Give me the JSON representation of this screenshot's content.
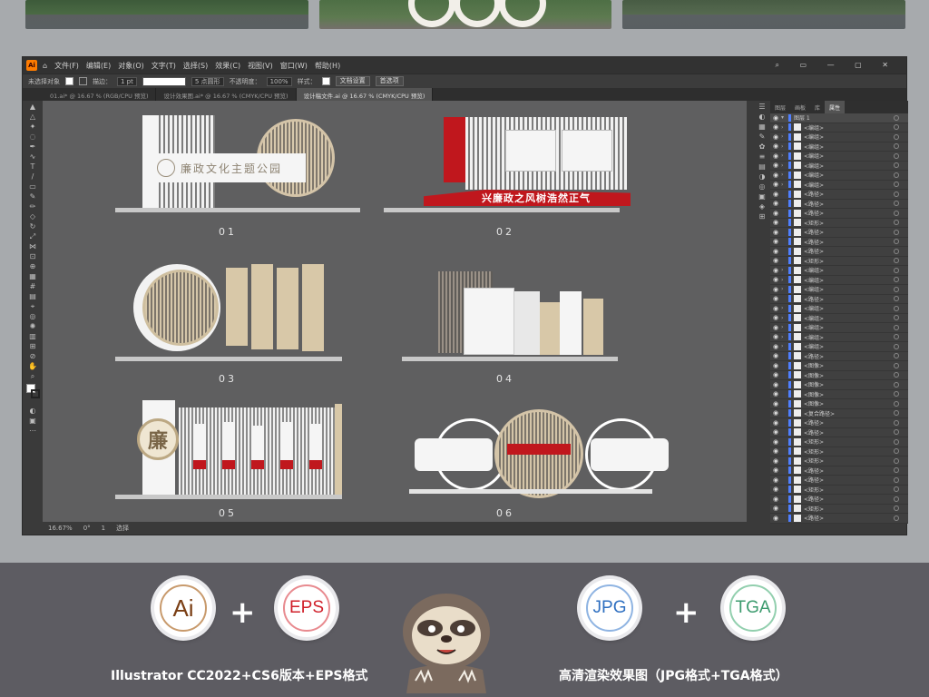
{
  "app": {
    "badge": "Ai",
    "menu": [
      "文件(F)",
      "编辑(E)",
      "对象(O)",
      "文字(T)",
      "选择(S)",
      "效果(C)",
      "视图(V)",
      "窗口(W)",
      "帮助(H)"
    ],
    "control": {
      "no_selection": "未选择对象",
      "stroke_label": "描边：",
      "stroke_value": "1 pt",
      "brush_label": "5 点圆形",
      "opacity_label": "不透明度：",
      "opacity_value": "100%",
      "style_label": "样式：",
      "doc_setup": "文档设置",
      "prefs": "首选项"
    },
    "tabs": [
      "01.ai* @ 16.67 % (RGB/CPU 预览)",
      "设计效果图.ai* @ 16.67 % (CMYK/CPU 预览)",
      "设计稿文件.ai @ 16.67 % (CMYK/CPU 预览)"
    ],
    "status": {
      "zoom": "16.67%",
      "angle": "0°",
      "page": "1",
      "tool": "选择"
    },
    "layers_panel": {
      "tabs": [
        "图层",
        "画板",
        "库",
        "属性"
      ],
      "top_layer": "图层 1",
      "rows": [
        "<编组>",
        "<编组>",
        "<编组>",
        "<编组>",
        "<编组>",
        "<编组>",
        "<编组>",
        "<路径>",
        "<路径>",
        "<路径>",
        "<矩形>",
        "<路径>",
        "<路径>",
        "<路径>",
        "<矩形>",
        "<编组>",
        "<编组>",
        "<编组>",
        "<路径>",
        "<编组>",
        "<编组>",
        "<编组>",
        "<编组>",
        "<编组>",
        "<路径>",
        "<图像>",
        "<图像>",
        "<图像>",
        "<图像>",
        "<图像>",
        "<复合路径>",
        "<路径>",
        "<路径>",
        "<矩形>",
        "<矩形>",
        "<矩形>",
        "<路径>",
        "<路径>",
        "<矩形>",
        "<路径>",
        "<矩形>",
        "<路径>"
      ]
    }
  },
  "designs": {
    "d01": {
      "title": "廉政文化主题公园",
      "number": "01"
    },
    "d02": {
      "title": "兴廉政之风树浩然正气",
      "number": "02"
    },
    "d03": {
      "number": "03"
    },
    "d04": {
      "number": "04"
    },
    "d05": {
      "char": "廉",
      "number": "05"
    },
    "d06": {
      "number": "06"
    }
  },
  "formats": {
    "ai": "Ai",
    "eps": "EPS",
    "jpg": "JPG",
    "tga": "TGA",
    "plus": "+",
    "caption_left": "Illustrator CC2022+CS6版本+EPS格式",
    "caption_right": "高清渲染效果图（JPG格式+TGA格式）"
  },
  "colors": {
    "ai_brown": "#7a3e14",
    "eps_red": "#d0202a",
    "jpg_blue": "#2e6fc0",
    "tga_green": "#3c9b6e",
    "party_red": "#c0171d"
  }
}
